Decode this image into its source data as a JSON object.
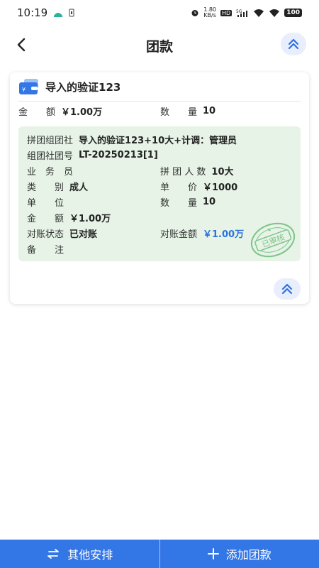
{
  "status": {
    "time": "10:19",
    "speed_top": "1.80",
    "speed_bottom": "KB/s",
    "hd": "HD",
    "network": "5G",
    "battery": "100"
  },
  "nav": {
    "title": "团款",
    "back_icon": "chevron-left-icon",
    "collapse_icon": "double-chevron-up-icon"
  },
  "card": {
    "title": "导入的验证123",
    "summary": {
      "amount_label": "金　　额",
      "amount_value": "￥1.00万",
      "qty_label": "数　　量",
      "qty_value": "10"
    },
    "detail": {
      "agency_label": "拼团组团社",
      "agency_value": "导入的验证123+10大+计调：管理员",
      "group_no_label": "组团社团号",
      "group_no_value": "LT-20250213[1]",
      "salesman_label": "业　务　员",
      "salesman_value": "",
      "people_label": "拼 团 人 数",
      "people_value": "10大",
      "category_label": "类　　别",
      "category_value": "成人",
      "price_label": "单　　价",
      "price_value": "￥1000",
      "unit_label": "单　　位",
      "unit_value": "",
      "qty_label": "数　　量",
      "qty_value": "10",
      "amount_label": "金　　额",
      "amount_value": "￥1.00万",
      "recon_status_label": "对账状态",
      "recon_status_value": "已对账",
      "recon_amount_label": "对账金额",
      "recon_amount_value": "￥1.00万",
      "remark_label": "备　　注",
      "remark_value": "",
      "stamp_text": "已审核"
    }
  },
  "bottom": {
    "other_label": "其他安排",
    "add_label": "添加团款"
  },
  "colors": {
    "primary": "#3376e6",
    "detail_bg": "#e6f3e6",
    "stamp": "#7cc48a",
    "link_blue": "#2d72e0"
  }
}
